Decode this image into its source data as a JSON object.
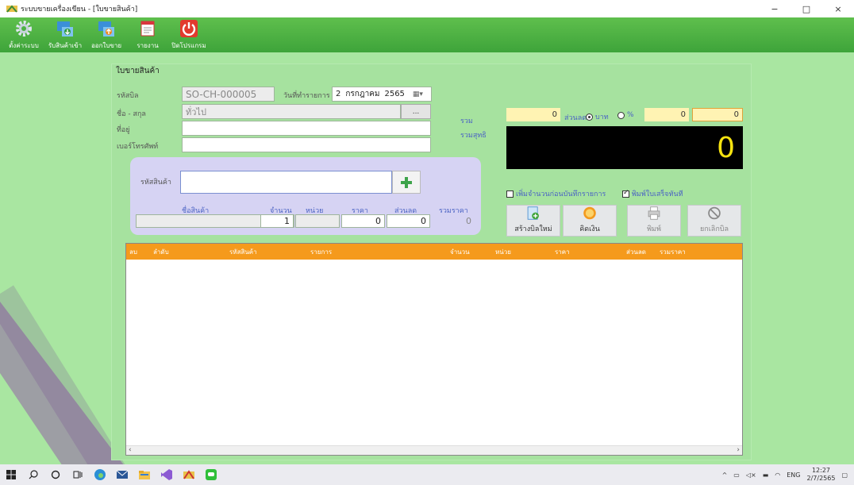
{
  "window": {
    "title": "ระบบขายเครื่องเขียน - [ใบขายสินค้า]",
    "minimize": "−",
    "maximize": "□",
    "close": "×"
  },
  "toolbar": {
    "items": [
      {
        "label": "ตั้งค่าระบบ",
        "icon": "gear-icon"
      },
      {
        "label": "รับสินค้าเข้า",
        "icon": "receive-goods-icon"
      },
      {
        "label": "ออกใบขาย",
        "icon": "sales-bill-icon"
      },
      {
        "label": "รายงาน",
        "icon": "report-icon"
      },
      {
        "label": "ปิดโปรแกรม",
        "icon": "power-icon"
      }
    ]
  },
  "form": {
    "title": "ใบขายสินค้า",
    "bill_id_label": "รหัสบิล",
    "bill_id_value": "SO-CH-000005",
    "date_label": "วันที่ทำรายการ",
    "date_day": "2",
    "date_month": "กรกฎาคม",
    "date_year": "2565",
    "name_label": "ชื่อ - สกุล",
    "name_value": "ทั่วไป",
    "browse_label": "...",
    "address_label": "ที่อยู่",
    "address_value": "",
    "phone_label": "เบอร์โทรศัพท์",
    "phone_value": ""
  },
  "product": {
    "code_label": "รหัสสินค้า",
    "code_value": "",
    "add_icon": "plus-icon",
    "name_label": "ชื่อสินค้า",
    "qty_label": "จำนวน",
    "unit_label": "หน่วย",
    "price_label": "ราคา",
    "discount_label": "ส่วนลด",
    "total_label": "รวมราคา",
    "name_value": "",
    "qty_value": "1",
    "unit_value": "",
    "price_value": "0",
    "discount_value": "0",
    "total_value": "0"
  },
  "summary": {
    "total_label": "รวม",
    "total_value": "0",
    "discount_label": "ส่วนลด",
    "baht_label": "บาท",
    "percent_label": "%",
    "discount_percent_value": "0",
    "discount_value": "0",
    "net_label": "รวมสุทธิ",
    "net_value": "0",
    "discount_mode": "บาท"
  },
  "options": {
    "add_qty_label": "เพิ่มจำนวนก่อนบันทึกรายการ",
    "add_qty_checked": false,
    "print_now_label": "พิมพ์ใบเสร็จทันที",
    "print_now_checked": true
  },
  "actions": {
    "new_bill": "สร้างบิลใหม่",
    "checkout": "คิดเงิน",
    "print": "พิมพ์",
    "cancel_bill": "ยกเลิกบิล"
  },
  "grid": {
    "columns": [
      "ลบ",
      "ลำดับ",
      "รหัสสินค้า",
      "รายการ",
      "จำนวน",
      "หน่วย",
      "ราคา",
      "ส่วนลด",
      "รวมราคา"
    ],
    "rows": [],
    "scroll_left": "‹",
    "scroll_right": "›"
  },
  "taskbar": {
    "tray_chevron": "^",
    "language": "ENG",
    "time": "12:27",
    "date": "2/7/2565"
  },
  "colors": {
    "toolbar": "#4cb244",
    "background": "#a9e6a1",
    "grid_header": "#f59a1c",
    "total_display_bg": "#000000",
    "total_display_fg": "#f6e310",
    "summary_field": "#fff3b3"
  }
}
